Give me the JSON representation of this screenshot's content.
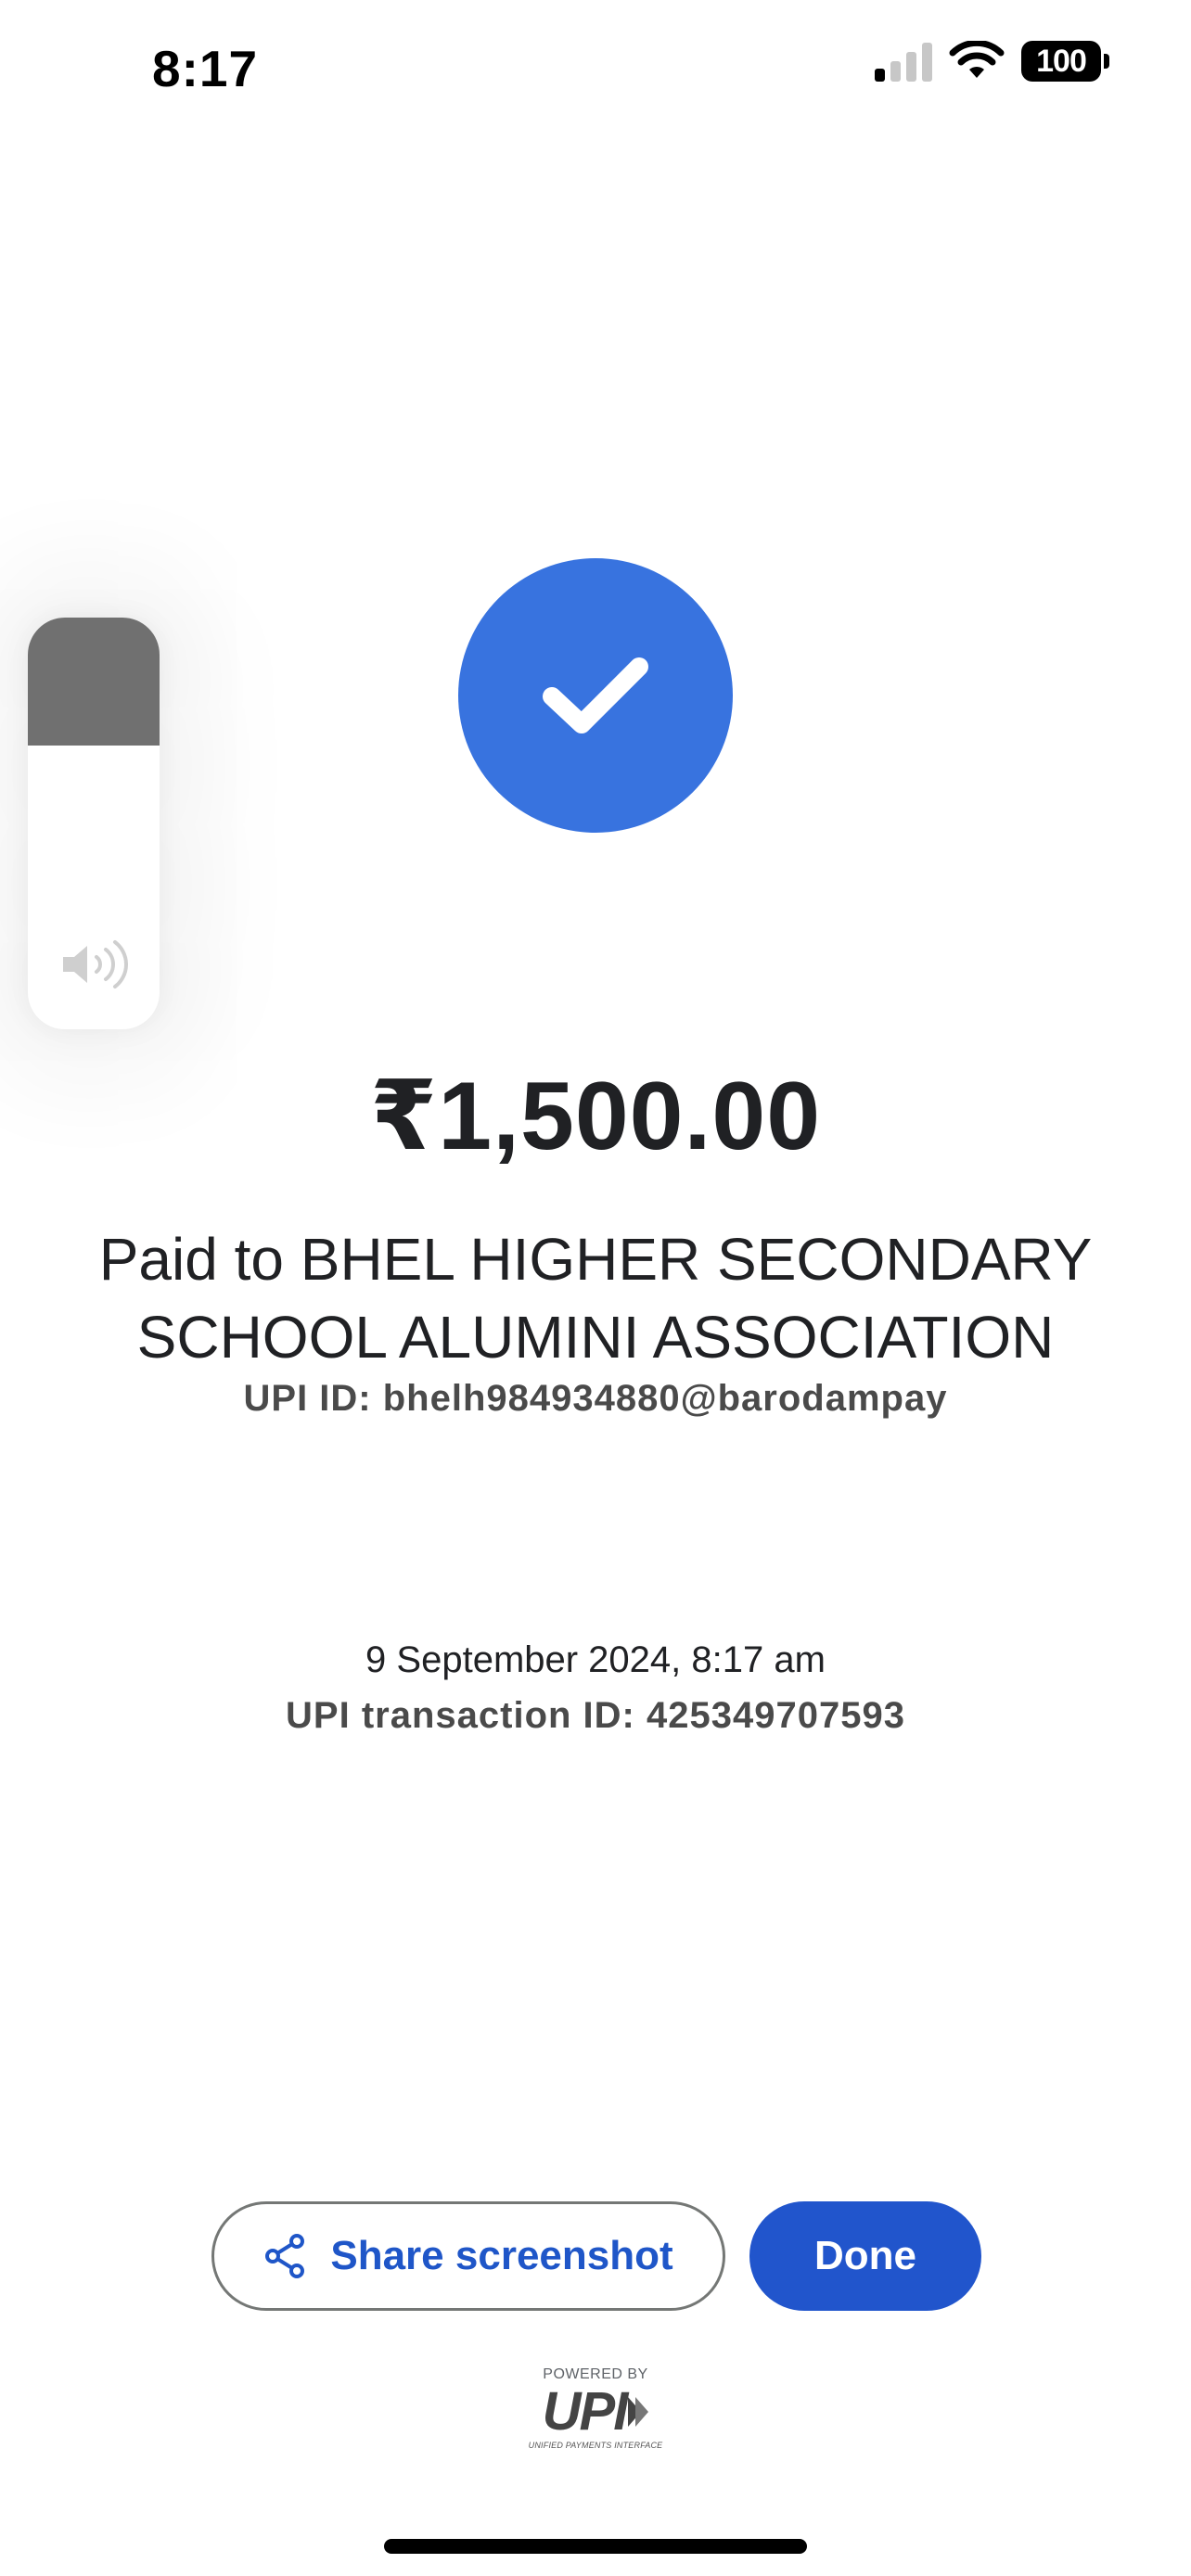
{
  "status_bar": {
    "time": "8:17",
    "battery": "100",
    "signal_bars_active": 1,
    "signal_bars_total": 4
  },
  "volume_hud": {
    "level": 0.31,
    "icon": "speaker-icon"
  },
  "payment": {
    "status_icon": "checkmark-icon",
    "amount": "₹1,500.00",
    "payee_line": "Paid to BHEL HIGHER SECONDARY SCHOOL ALUMINI ASSOCIATION",
    "upi_id": "UPI ID: bhelh984934880@barodampay",
    "date_time": "9 September 2024, 8:17 am",
    "transaction_id": "UPI transaction ID: 425349707593"
  },
  "actions": {
    "share_label": "Share screenshot",
    "share_icon": "share-icon",
    "done_label": "Done"
  },
  "footer": {
    "powered_by": "POWERED BY",
    "upi_text": "UPI",
    "upi_subtitle": "UNIFIED PAYMENTS INTERFACE"
  },
  "colors": {
    "success_blue": "#3873df",
    "primary_button": "#2155cc",
    "link_blue": "#1f56c8"
  }
}
